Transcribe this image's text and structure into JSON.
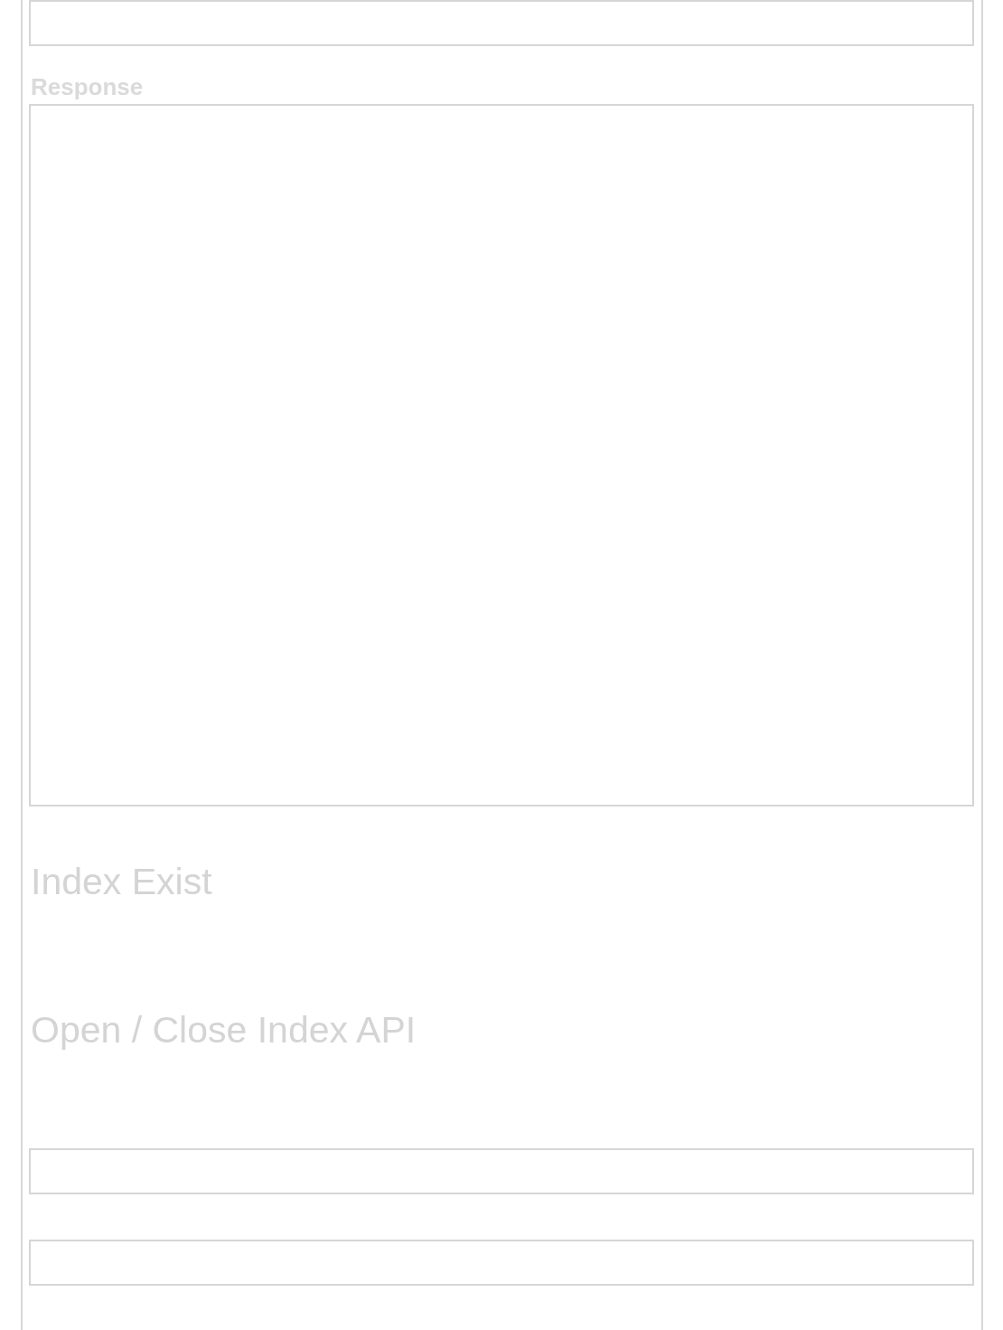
{
  "items": [
    {
      "kind": "field"
    },
    {
      "kind": "label",
      "text": "Response"
    },
    {
      "kind": "textarea"
    },
    {
      "kind": "heading",
      "text": "Index Exist"
    },
    {
      "kind": "heading",
      "text": "Open / Close Index API"
    },
    {
      "kind": "field"
    },
    {
      "kind": "field"
    }
  ]
}
